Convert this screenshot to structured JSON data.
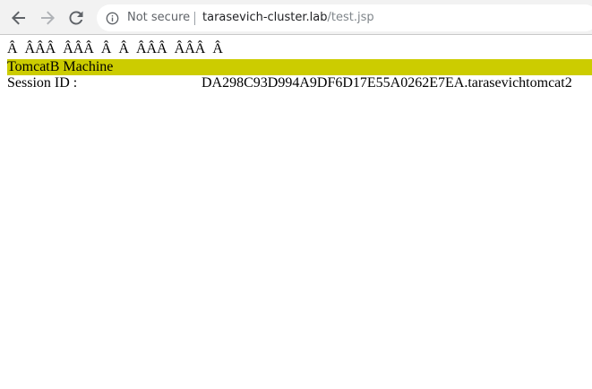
{
  "browser": {
    "security_label": "Not secure",
    "url_host": "tarasevich-cluster.lab",
    "url_path": "/test.jsp"
  },
  "page": {
    "garbled_line": "Â  ÂÂÂ  ÂÂÂ  Â  Â  ÂÂÂ  ÂÂÂ  Â",
    "banner_text": "TomcatB Machine",
    "banner_color": "#cccc00",
    "session_label": "Session ID :",
    "session_value": "DA298C93D994A9DF6D17E55A0262E7EA.tarasevichtomcat2"
  }
}
